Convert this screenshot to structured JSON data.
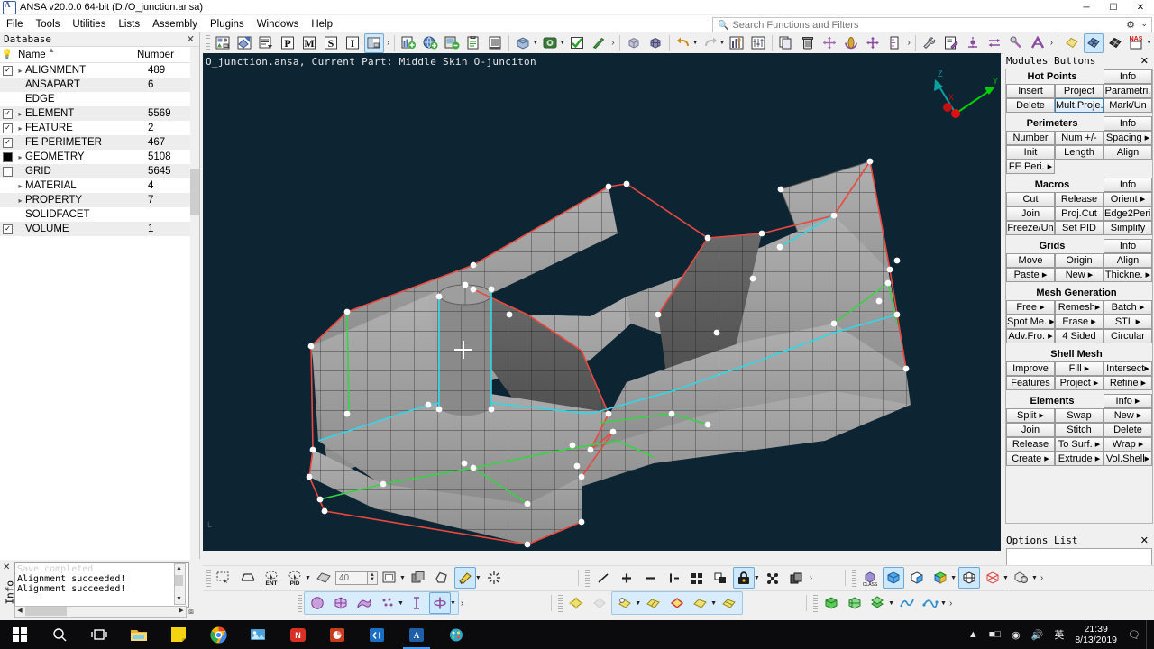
{
  "window": {
    "title": "ANSA v20.0.0 64-bit (D:/O_junction.ansa)",
    "app_icon": "ansa-logo-icon",
    "minimize": "─",
    "maximize": "☐",
    "close": "✕"
  },
  "menubar": {
    "items": [
      "File",
      "Tools",
      "Utilities",
      "Lists",
      "Assembly",
      "Plugins",
      "Windows",
      "Help"
    ]
  },
  "search": {
    "placeholder": "Search Functions and Filters",
    "value": "",
    "icon": "search-icon",
    "gear": "⚙",
    "chevron": "⌄"
  },
  "database": {
    "title": "Database",
    "close": "✕",
    "columns": [
      "Name",
      "Number"
    ],
    "rows": [
      {
        "label": "ALIGNMENT",
        "number": "489",
        "check": "checked",
        "expand": true,
        "alt": false
      },
      {
        "label": "ANSAPART",
        "number": "6",
        "check": "none",
        "expand": false,
        "alt": true
      },
      {
        "label": "EDGE",
        "number": "",
        "check": "none",
        "expand": false,
        "alt": false
      },
      {
        "label": "ELEMENT",
        "number": "5569",
        "check": "checked",
        "expand": true,
        "alt": true
      },
      {
        "label": "FEATURE",
        "number": "2",
        "check": "checked",
        "expand": true,
        "alt": false
      },
      {
        "label": "FE PERIMETER",
        "number": "467",
        "check": "checked",
        "expand": false,
        "alt": true
      },
      {
        "label": "GEOMETRY",
        "number": "5108",
        "check": "partial",
        "expand": true,
        "alt": false
      },
      {
        "label": "GRID",
        "number": "5645",
        "check": "empty",
        "expand": false,
        "alt": true
      },
      {
        "label": "MATERIAL",
        "number": "4",
        "check": "none",
        "expand": true,
        "alt": false
      },
      {
        "label": "PROPERTY",
        "number": "7",
        "check": "none",
        "expand": true,
        "alt": true
      },
      {
        "label": "SOLIDFACET",
        "number": "",
        "check": "none",
        "expand": false,
        "alt": false
      },
      {
        "label": "VOLUME",
        "number": "1",
        "check": "checked",
        "expand": false,
        "alt": true
      }
    ]
  },
  "info_panel": {
    "tab_label": "Info",
    "close": "✕",
    "lines": [
      "Save completed",
      "Alignment succeeded!",
      "Alignment succeeded!"
    ]
  },
  "viewport": {
    "status_text": "O_junction.ansa,  Current Part: Middle Skin O-junciton",
    "background_color": "#0d2433",
    "axis_labels": [
      "X",
      "Y",
      "Z"
    ],
    "colors": {
      "mesh_fill": "#9a9a9a",
      "perimeter_red": "#e8493f",
      "perimeter_cyan": "#2fd8e8",
      "perimeter_green": "#35d445",
      "hot_point": "#ffffff",
      "axis_green": "#00d000",
      "axis_teal": "#00a0a0",
      "axis_red": "#d01010"
    }
  },
  "modules": {
    "title": "Modules Buttons",
    "close": "✕",
    "groups": [
      {
        "title": "Hot Points",
        "info": "Info",
        "rows": [
          [
            "Insert",
            "Project",
            "Parametri."
          ],
          [
            "Delete",
            "Mult.Proje.",
            "Mark/Un"
          ]
        ],
        "active": "Mult.Proje."
      },
      {
        "title": "Perimeters",
        "info": "Info",
        "rows": [
          [
            "Number",
            "Num +/-",
            "Spacing ▸"
          ],
          [
            "Init",
            "Length",
            "Align"
          ],
          [
            "FE Peri. ▸"
          ]
        ]
      },
      {
        "title": "Macros",
        "info": "Info",
        "rows": [
          [
            "Cut",
            "Release",
            "Orient  ▸"
          ],
          [
            "Join",
            "Proj.Cut",
            "Edge2Peri."
          ],
          [
            "Freeze/Un",
            "Set PID",
            "Simplify"
          ]
        ]
      },
      {
        "title": "Grids",
        "info": "Info",
        "rows": [
          [
            "Move",
            "Origin",
            "Align"
          ],
          [
            "Paste  ▸",
            "New   ▸",
            "Thickne. ▸"
          ]
        ]
      },
      {
        "title": "Mesh Generation",
        "info": "",
        "rows": [
          [
            "Free   ▸",
            "Remesh▸",
            "Batch  ▸"
          ],
          [
            "Spot Me. ▸",
            "Erase  ▸",
            "STL   ▸"
          ],
          [
            "Adv.Fro. ▸",
            "4 Sided",
            "Circular"
          ]
        ]
      },
      {
        "title": "Shell Mesh",
        "info": "",
        "rows": [
          [
            "Improve",
            "Fill   ▸",
            "Intersect▸"
          ],
          [
            "Features",
            "Project ▸",
            "Refine  ▸"
          ]
        ]
      },
      {
        "title": "Elements",
        "info": "Info ▸",
        "rows": [
          [
            "Split  ▸",
            "Swap",
            "New   ▸"
          ],
          [
            "Join",
            "Stitch",
            "Delete"
          ],
          [
            "Release",
            "To Surf. ▸",
            "Wrap  ▸"
          ],
          [
            "Create ▸",
            "Extrude ▸",
            "Vol.Shell▸"
          ]
        ]
      }
    ]
  },
  "options_list": {
    "title": "Options List",
    "close": "✕"
  },
  "toolbar_top": {
    "icons": [
      "database-browser-icon",
      "part-manager-icon",
      "list-icon",
      "property-icon",
      "material-icon",
      "set-icon",
      "include-icon",
      "window-layout-icon",
      "overflow-chevron-icon",
      "new-model-icon",
      "open-model-icon",
      "merge-model-icon",
      "output-icon",
      "report-icon",
      "view-icon",
      "render-icon",
      "check-icon",
      "pick-icon",
      "overflow2-chevron-icon",
      "solid-box-icon",
      "mesh-box-icon",
      "undo-icon",
      "redo-icon",
      "settings-sliders-icon",
      "options-icon",
      "copy-icon",
      "delete-icon",
      "move-icon",
      "rotate-icon",
      "translate-icon",
      "measure-icon",
      "overflow3-chevron-icon",
      "tools-wrench-icon",
      "edit-note-icon",
      "node-move-icon",
      "swap-icon",
      "screw-icon",
      "connection-icon",
      "overflow4-chevron-icon",
      "geometry-face-icon",
      "shell-mesh-icon",
      "volume-mesh-icon",
      "nastran-deck-icon",
      "solid-mesh-icon",
      "layer-mesh-icon",
      "connections-icon",
      "overflow5-chevron-icon"
    ],
    "selected": [
      "window-layout-icon",
      "shell-mesh-icon"
    ],
    "nastran_label": "NAS"
  },
  "toolbar_bottom_row1": {
    "left_icons": [
      "rect-select-icon",
      "feature-line-icon",
      "ent-select-icon",
      "pid-select-icon",
      "dropdown-icon",
      "shade-icon"
    ],
    "number_value": "40",
    "mid_icons": [
      "frame-icon",
      "dropdown2-icon",
      "copy-layer-icon",
      "polygon-icon",
      "paint-icon",
      "dropdown3-icon",
      "highlight-icon"
    ],
    "draw_icons": [
      "line-icon",
      "plus-icon",
      "minus-icon",
      "not-icon",
      "grid4-icon",
      "shadow-icon",
      "lock-icon",
      "dropdown4-icon",
      "nodes-icon",
      "layers-icon",
      "overflow-chevron-icon"
    ],
    "view_icons": [
      "class-icon",
      "cube-blue-icon",
      "cube-half-icon",
      "cube-colored-icon",
      "dropdown5-icon",
      "wire-cube-icon",
      "section-icon",
      "dropdown6-icon",
      "gear-cube-icon",
      "dropdown7-icon",
      "overflow-chevron2-icon"
    ],
    "selected": [
      "paint-icon",
      "lock-icon",
      "cube-blue-icon",
      "wire-cube-icon"
    ]
  },
  "toolbar_bottom_row2": {
    "left_icons": [
      "circle-icon",
      "cube-split-icon",
      "ribbon-icon",
      "points-icon",
      "dropdown-icon",
      "text-cursor-icon",
      "axis-icon",
      "dropdown2-icon",
      "overflow-chevron-icon"
    ],
    "mid_icons": [
      "quad-node-icon",
      "quad-ghost-icon",
      "quad-point-icon",
      "dropdown3-icon",
      "quad-pair-icon",
      "diamond-icon",
      "quad-single-icon",
      "dropdown4-icon",
      "quad-split-icon"
    ],
    "right_icons": [
      "green-cube-icon",
      "green-mesh-icon",
      "green-stack-icon",
      "dropdown5-icon",
      "curve-icon",
      "spline-icon",
      "dropdown6-icon",
      "overflow-chevron2-icon"
    ]
  },
  "taskbar": {
    "items": [
      "start-icon",
      "search-icon",
      "task-view-icon",
      "file-explorer-icon",
      "notes-icon",
      "chrome-icon",
      "photos-icon",
      "netease-icon",
      "ppt-icon",
      "code-icon",
      "ansa-icon",
      "paint-icon"
    ],
    "active_item": "ansa-icon",
    "tray_icons": [
      "chevron-up-icon",
      "battery-icon",
      "wifi-icon",
      "volume-icon",
      "ime-icon"
    ],
    "time": "21:39",
    "date": "8/13/2019",
    "action_center": "notification-icon"
  }
}
